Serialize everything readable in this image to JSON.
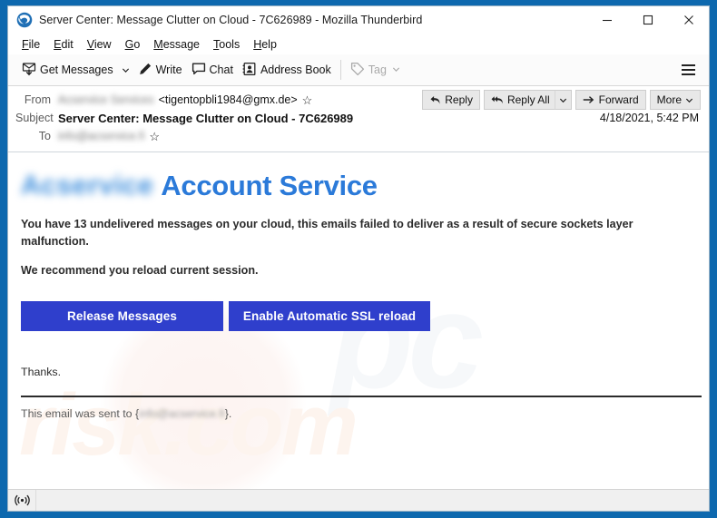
{
  "window": {
    "title": "Server Center: Message Clutter on Cloud - 7C626989 - Mozilla Thunderbird",
    "app_icon": "thunderbird-icon",
    "minimize_label": "–",
    "maximize_label": "□",
    "close_label": "✕"
  },
  "menubar": {
    "items": [
      {
        "label": "File",
        "mnemonic": "F"
      },
      {
        "label": "Edit",
        "mnemonic": "E"
      },
      {
        "label": "View",
        "mnemonic": "V"
      },
      {
        "label": "Go",
        "mnemonic": "G"
      },
      {
        "label": "Message",
        "mnemonic": "M"
      },
      {
        "label": "Tools",
        "mnemonic": "T"
      },
      {
        "label": "Help",
        "mnemonic": "H"
      }
    ]
  },
  "toolbar": {
    "get_messages": "Get Messages",
    "write": "Write",
    "chat": "Chat",
    "address_book": "Address Book",
    "tag": "Tag",
    "menu_button": "app-menu"
  },
  "message_header": {
    "from_label": "From",
    "from_name_redacted": "Acservice Services",
    "from_address": "<tigentopbli1984@gmx.de>",
    "subject_label": "Subject",
    "subject": "Server Center: Message Clutter on Cloud - 7C626989",
    "date": "4/18/2021, 5:42 PM",
    "to_label": "To",
    "to_redacted": "info@acservice.fi",
    "star_glyph": "☆",
    "actions": {
      "reply": "Reply",
      "reply_all": "Reply All",
      "forward": "Forward",
      "more": "More"
    }
  },
  "email_body": {
    "brand_logo_redacted": "Acservice",
    "brand_title": "Account Service",
    "paragraph_1": "You have 13 undelivered messages on your cloud, this emails failed to deliver as a result of secure sockets layer malfunction.",
    "paragraph_2": "We recommend you reload current session.",
    "button_release": "Release Messages",
    "button_enable": "Enable Automatic SSL reload",
    "thanks": "Thanks.",
    "sent_to_prefix": "This email was sent to {",
    "sent_to_redacted": "info@acservice.fi",
    "sent_to_suffix": "}.",
    "watermark_main": "risk.com",
    "watermark_secondary": "pc",
    "colors": {
      "brand_title": "#2b7ad9",
      "cta_button": "#2f3fcc",
      "cta_text": "#ffffff"
    }
  },
  "statusbar": {
    "connection_icon": "broadcast-icon"
  }
}
